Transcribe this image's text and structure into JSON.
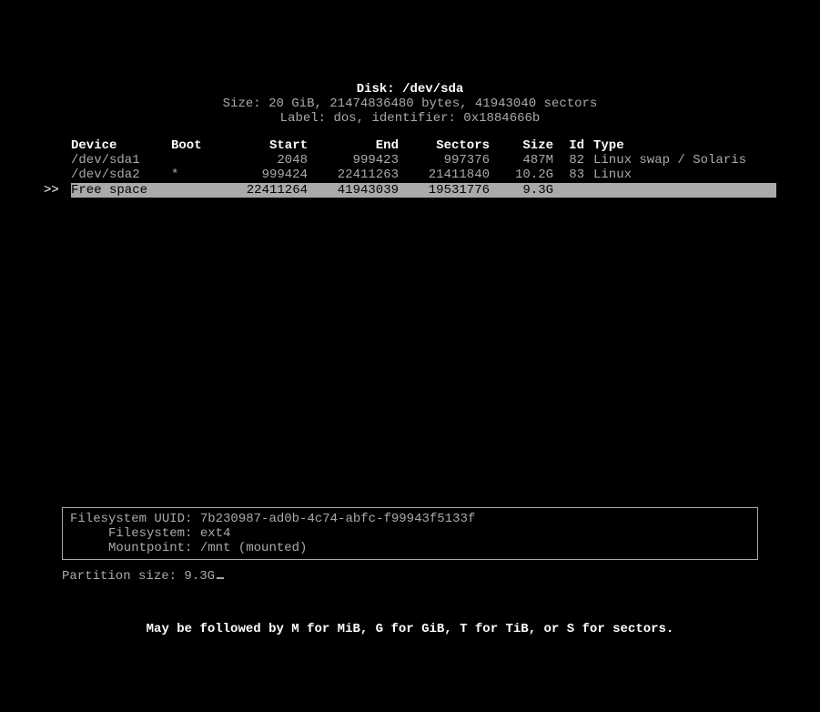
{
  "header": {
    "disk_label": "Disk: /dev/sda",
    "size_line": "Size: 20 GiB, 21474836480 bytes, 41943040 sectors",
    "label_line": "Label: dos, identifier: 0x1884666b"
  },
  "columns": {
    "device": "Device",
    "boot": "Boot",
    "start": "Start",
    "end": "End",
    "sectors": "Sectors",
    "size": "Size",
    "id": "Id",
    "type": "Type"
  },
  "rows": [
    {
      "ptr": "",
      "device": "/dev/sda1",
      "boot": "",
      "start": "2048",
      "end": "999423",
      "sectors": "997376",
      "size": "487M",
      "id": "82",
      "type": "Linux swap / Solaris",
      "selected": false
    },
    {
      "ptr": "",
      "device": "/dev/sda2",
      "boot": "*",
      "start": "999424",
      "end": "22411263",
      "sectors": "21411840",
      "size": "10.2G",
      "id": "83",
      "type": "Linux",
      "selected": false
    },
    {
      "ptr": ">>",
      "device": "Free space",
      "boot": "",
      "start": "22411264",
      "end": "41943039",
      "sectors": "19531776",
      "size": "9.3G",
      "id": "",
      "type": "",
      "selected": true
    }
  ],
  "info": {
    "uuid_label": "Filesystem UUID: ",
    "uuid": "7b230987-ad0b-4c74-abfc-f99943f5133f",
    "fs_label": "     Filesystem: ",
    "fs": "ext4",
    "mp_label": "     Mountpoint: ",
    "mp": "/mnt (mounted)"
  },
  "prompt": {
    "label": "Partition size: ",
    "value": "9.3G"
  },
  "hint": "May be followed by M for MiB, G for GiB, T for TiB, or S for sectors."
}
